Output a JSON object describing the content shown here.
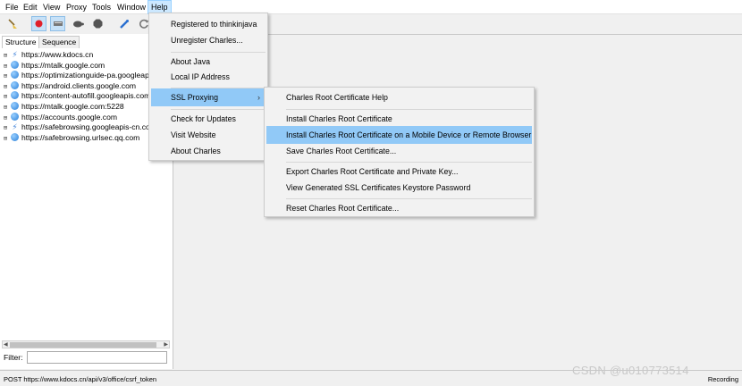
{
  "menubar": {
    "items": [
      "File",
      "Edit",
      "View",
      "Proxy",
      "Tools",
      "Window",
      "Help"
    ]
  },
  "toolbar": {
    "icons": [
      "broom-icon",
      "record-icon",
      "throttle-icon",
      "turtle-icon",
      "breakpoint-icon",
      "pen-icon",
      "refresh-icon"
    ]
  },
  "left": {
    "tabs": [
      "Structure",
      "Sequence"
    ],
    "hosts": [
      {
        "label": "https://www.kdocs.cn",
        "icon": "bolt-icon"
      },
      {
        "label": "https://mtalk.google.com",
        "icon": "globe-icon"
      },
      {
        "label": "https://optimizationguide-pa.googleapis.co",
        "icon": "globe-icon"
      },
      {
        "label": "https://android.clients.google.com",
        "icon": "globe-icon"
      },
      {
        "label": "https://content-autofill.googleapis.com",
        "icon": "globe-icon"
      },
      {
        "label": "https://mtalk.google.com:5228",
        "icon": "globe-icon"
      },
      {
        "label": "https://accounts.google.com",
        "icon": "globe-icon"
      },
      {
        "label": "https://safebrowsing.googleapis-cn.com",
        "icon": "bolt-icon"
      },
      {
        "label": "https://safebrowsing.urlsec.qq.com",
        "icon": "globe-icon"
      }
    ],
    "filter_label": "Filter:",
    "filter_value": ""
  },
  "help_menu": {
    "items": [
      "Registered to thinkinjava",
      "Unregister Charles...",
      "About Java",
      "Local IP Address",
      "SSL Proxying",
      "Check for Updates",
      "Visit Website",
      "About Charles"
    ]
  },
  "ssl_menu": {
    "items": [
      "Charles Root Certificate Help",
      "Install Charles Root Certificate",
      "Install Charles Root Certificate on a Mobile Device or Remote Browser",
      "Save Charles Root Certificate...",
      "Export Charles Root Certificate and Private Key...",
      "View Generated SSL Certificates Keystore Password",
      "Reset Charles Root Certificate..."
    ]
  },
  "status": {
    "left": "POST https://www.kdocs.cn/api/v3/office/csrf_token",
    "right": "Recording"
  },
  "watermark": "CSDN @u010773514"
}
